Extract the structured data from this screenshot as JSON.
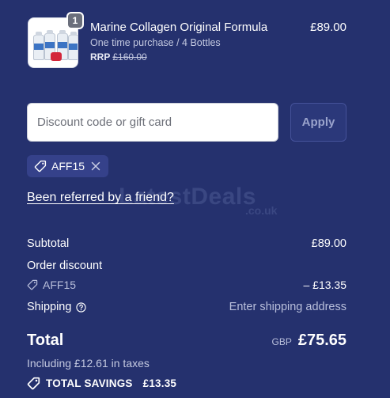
{
  "cart": {
    "item": {
      "name": "Marine Collagen Original Formula",
      "variant": "One time purchase / 4 Bottles",
      "rrp_label": "RRP",
      "rrp_value": "£160.00",
      "price": "£89.00",
      "quantity": "1"
    }
  },
  "discount": {
    "placeholder": "Discount code or gift card",
    "apply_label": "Apply",
    "applied_code": "AFF15"
  },
  "referral": {
    "link_text": "Been referred by a friend?"
  },
  "watermark": {
    "main": "LatestDeals",
    "sub": ".co.uk"
  },
  "summary": {
    "subtotal_label": "Subtotal",
    "subtotal_value": "£89.00",
    "order_discount_label": "Order discount",
    "discount_code": "AFF15",
    "discount_value": "– £13.35",
    "shipping_label": "Shipping",
    "shipping_value": "Enter shipping address",
    "total_label": "Total",
    "currency": "GBP",
    "total_value": "£75.65",
    "tax_line": "Including £12.61 in taxes",
    "savings_label": "TOTAL SAVINGS",
    "savings_value": "£13.35"
  },
  "colors": {
    "background": "#25316e",
    "chip": "#35418a",
    "apply_button": "#2b387a",
    "text": "#ffffff"
  },
  "icons": [
    "tag-icon",
    "close-icon",
    "help-circle-icon"
  ]
}
